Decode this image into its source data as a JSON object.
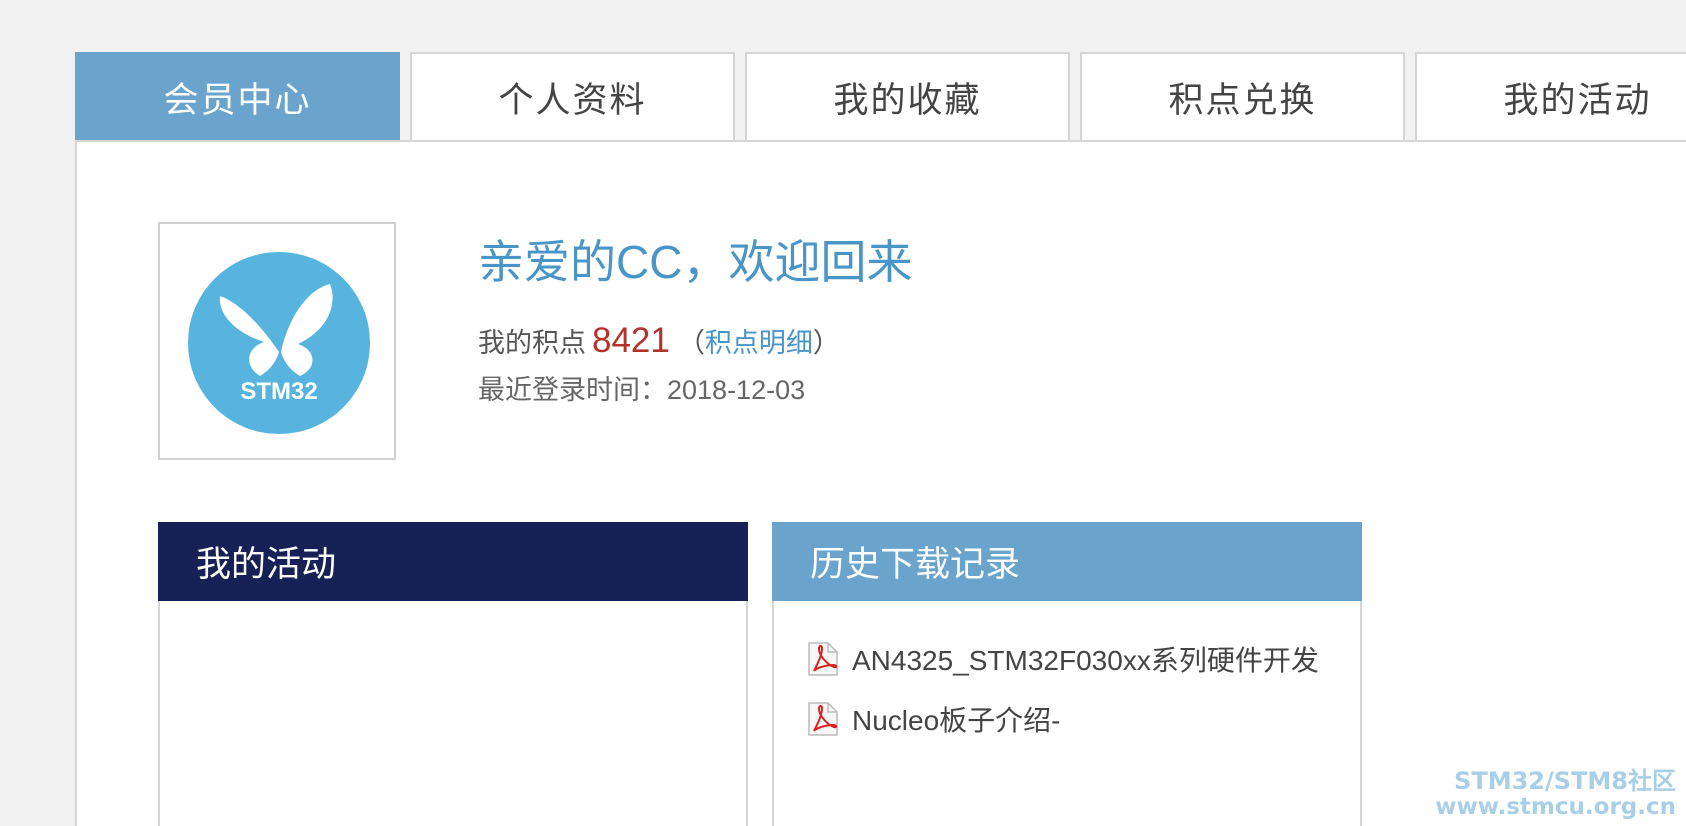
{
  "tabs": [
    {
      "label": "会员中心",
      "active": true
    },
    {
      "label": "个人资料",
      "active": false
    },
    {
      "label": "我的收藏",
      "active": false
    },
    {
      "label": "积点兑换",
      "active": false
    },
    {
      "label": "我的活动",
      "active": false
    }
  ],
  "profile": {
    "avatar_text": "STM32",
    "welcome": "亲爱的CC，欢迎回来",
    "points_label": "我的积点",
    "points_value": "8421",
    "points_detail_open": "（",
    "points_detail_link": "积点明细",
    "points_detail_close": "）",
    "last_login": "最近登录时间：2018-12-03"
  },
  "activity_card": {
    "title": "我的活动"
  },
  "download_card": {
    "title": "历史下载记录",
    "items": [
      {
        "name": "AN4325_STM32F030xx系列硬件开发",
        "icon": "pdf-icon"
      },
      {
        "name": "Nucleo板子介绍-",
        "icon": "pdf-icon"
      }
    ]
  },
  "watermark": {
    "line1": "STM32/STM8社区",
    "line2": "www.stmcu.org.cn"
  },
  "colors": {
    "accent": "#6aa3cc",
    "link": "#4a95c8",
    "dark_header": "#172155",
    "points": "#b3322b",
    "logo": "#57b4df"
  }
}
